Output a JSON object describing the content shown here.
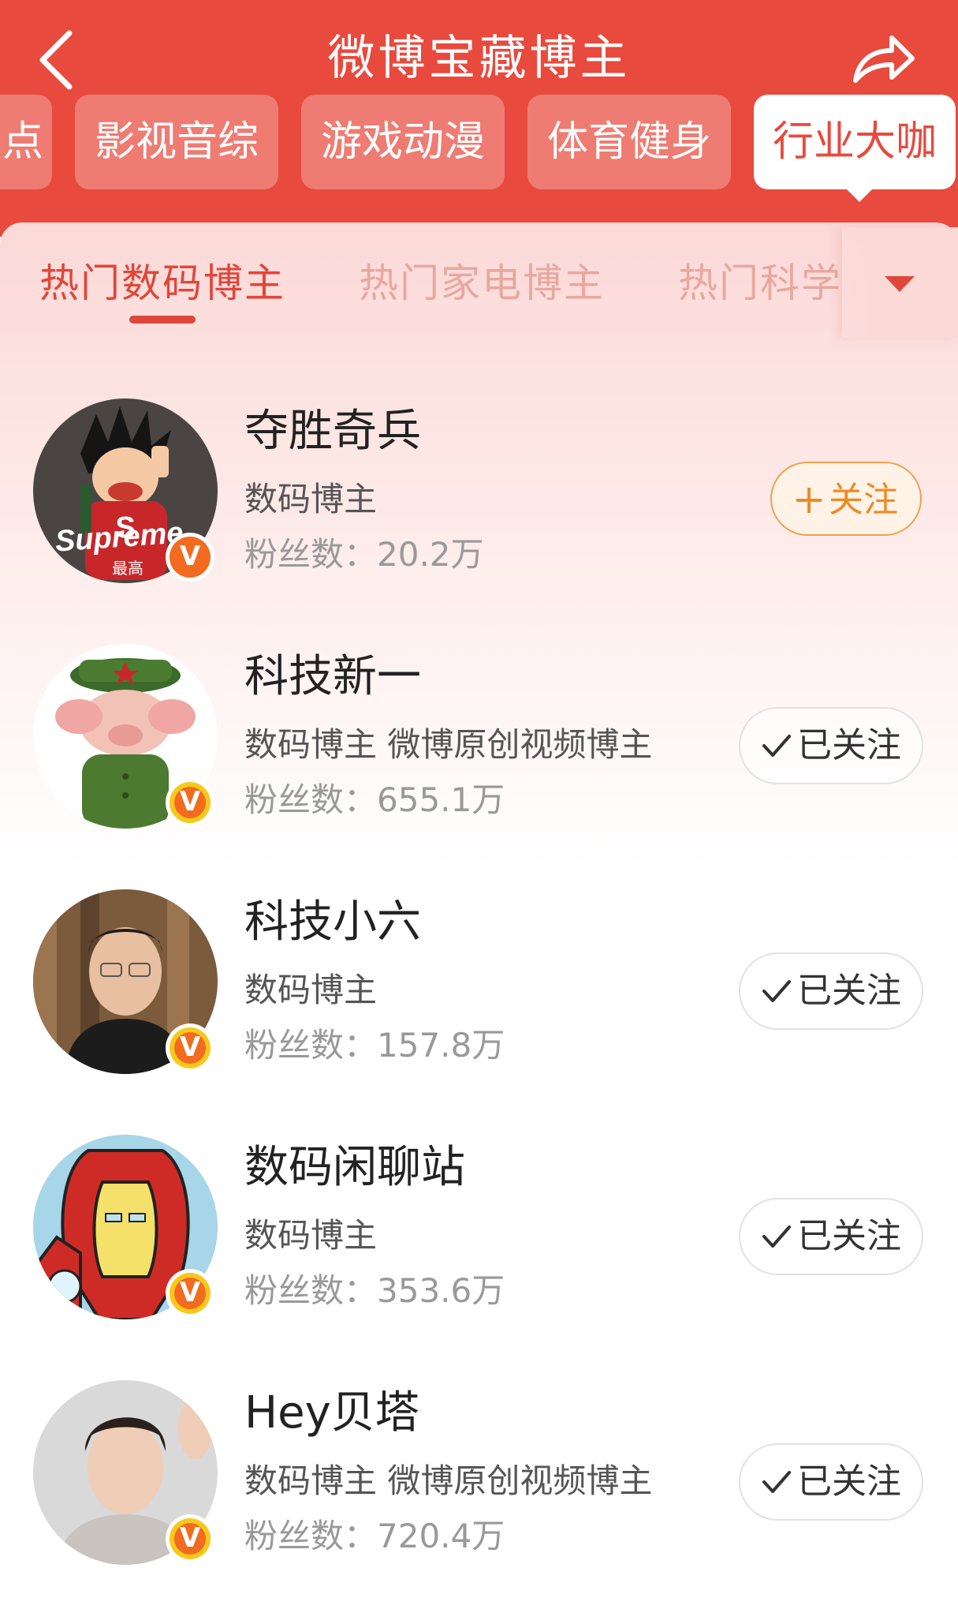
{
  "header": {
    "title": "微博宝藏博主",
    "back_icon": "chevron-left-icon",
    "share_icon": "share-arrow-icon",
    "background": "#e84a3e"
  },
  "categories": [
    {
      "label": "点",
      "active": false
    },
    {
      "label": "影视音综",
      "active": false
    },
    {
      "label": "游戏动漫",
      "active": false
    },
    {
      "label": "体育健身",
      "active": false
    },
    {
      "label": "行业大咖",
      "active": true
    }
  ],
  "subtabs": [
    {
      "label": "热门数码博主",
      "active": true
    },
    {
      "label": "热门家电博主",
      "active": false
    },
    {
      "label": "热门科学",
      "active": false
    }
  ],
  "dropdown_icon": "caret-down-icon",
  "bloggers": [
    {
      "name": "夺胜奇兵",
      "tags": "数码博主",
      "fans": "粉丝数：20.2万",
      "button": "关注",
      "followed": false,
      "avatar_text": "Supreme",
      "avatar_sub": "最高",
      "verified_color": "orange"
    },
    {
      "name": "科技新一",
      "tags": "数码博主 微博原创视频博主",
      "fans": "粉丝数：655.1万",
      "button": "已关注",
      "followed": true,
      "verified_color": "gold"
    },
    {
      "name": "科技小六",
      "tags": "数码博主",
      "fans": "粉丝数：157.8万",
      "button": "已关注",
      "followed": true,
      "verified_color": "gold"
    },
    {
      "name": "数码闲聊站",
      "tags": "数码博主",
      "fans": "粉丝数：353.6万",
      "button": "已关注",
      "followed": true,
      "verified_color": "gold"
    },
    {
      "name": "Hey贝塔",
      "tags": "数码博主 微博原创视频博主",
      "fans": "粉丝数：720.4万",
      "button": "已关注",
      "followed": true,
      "verified_color": "gold"
    }
  ]
}
